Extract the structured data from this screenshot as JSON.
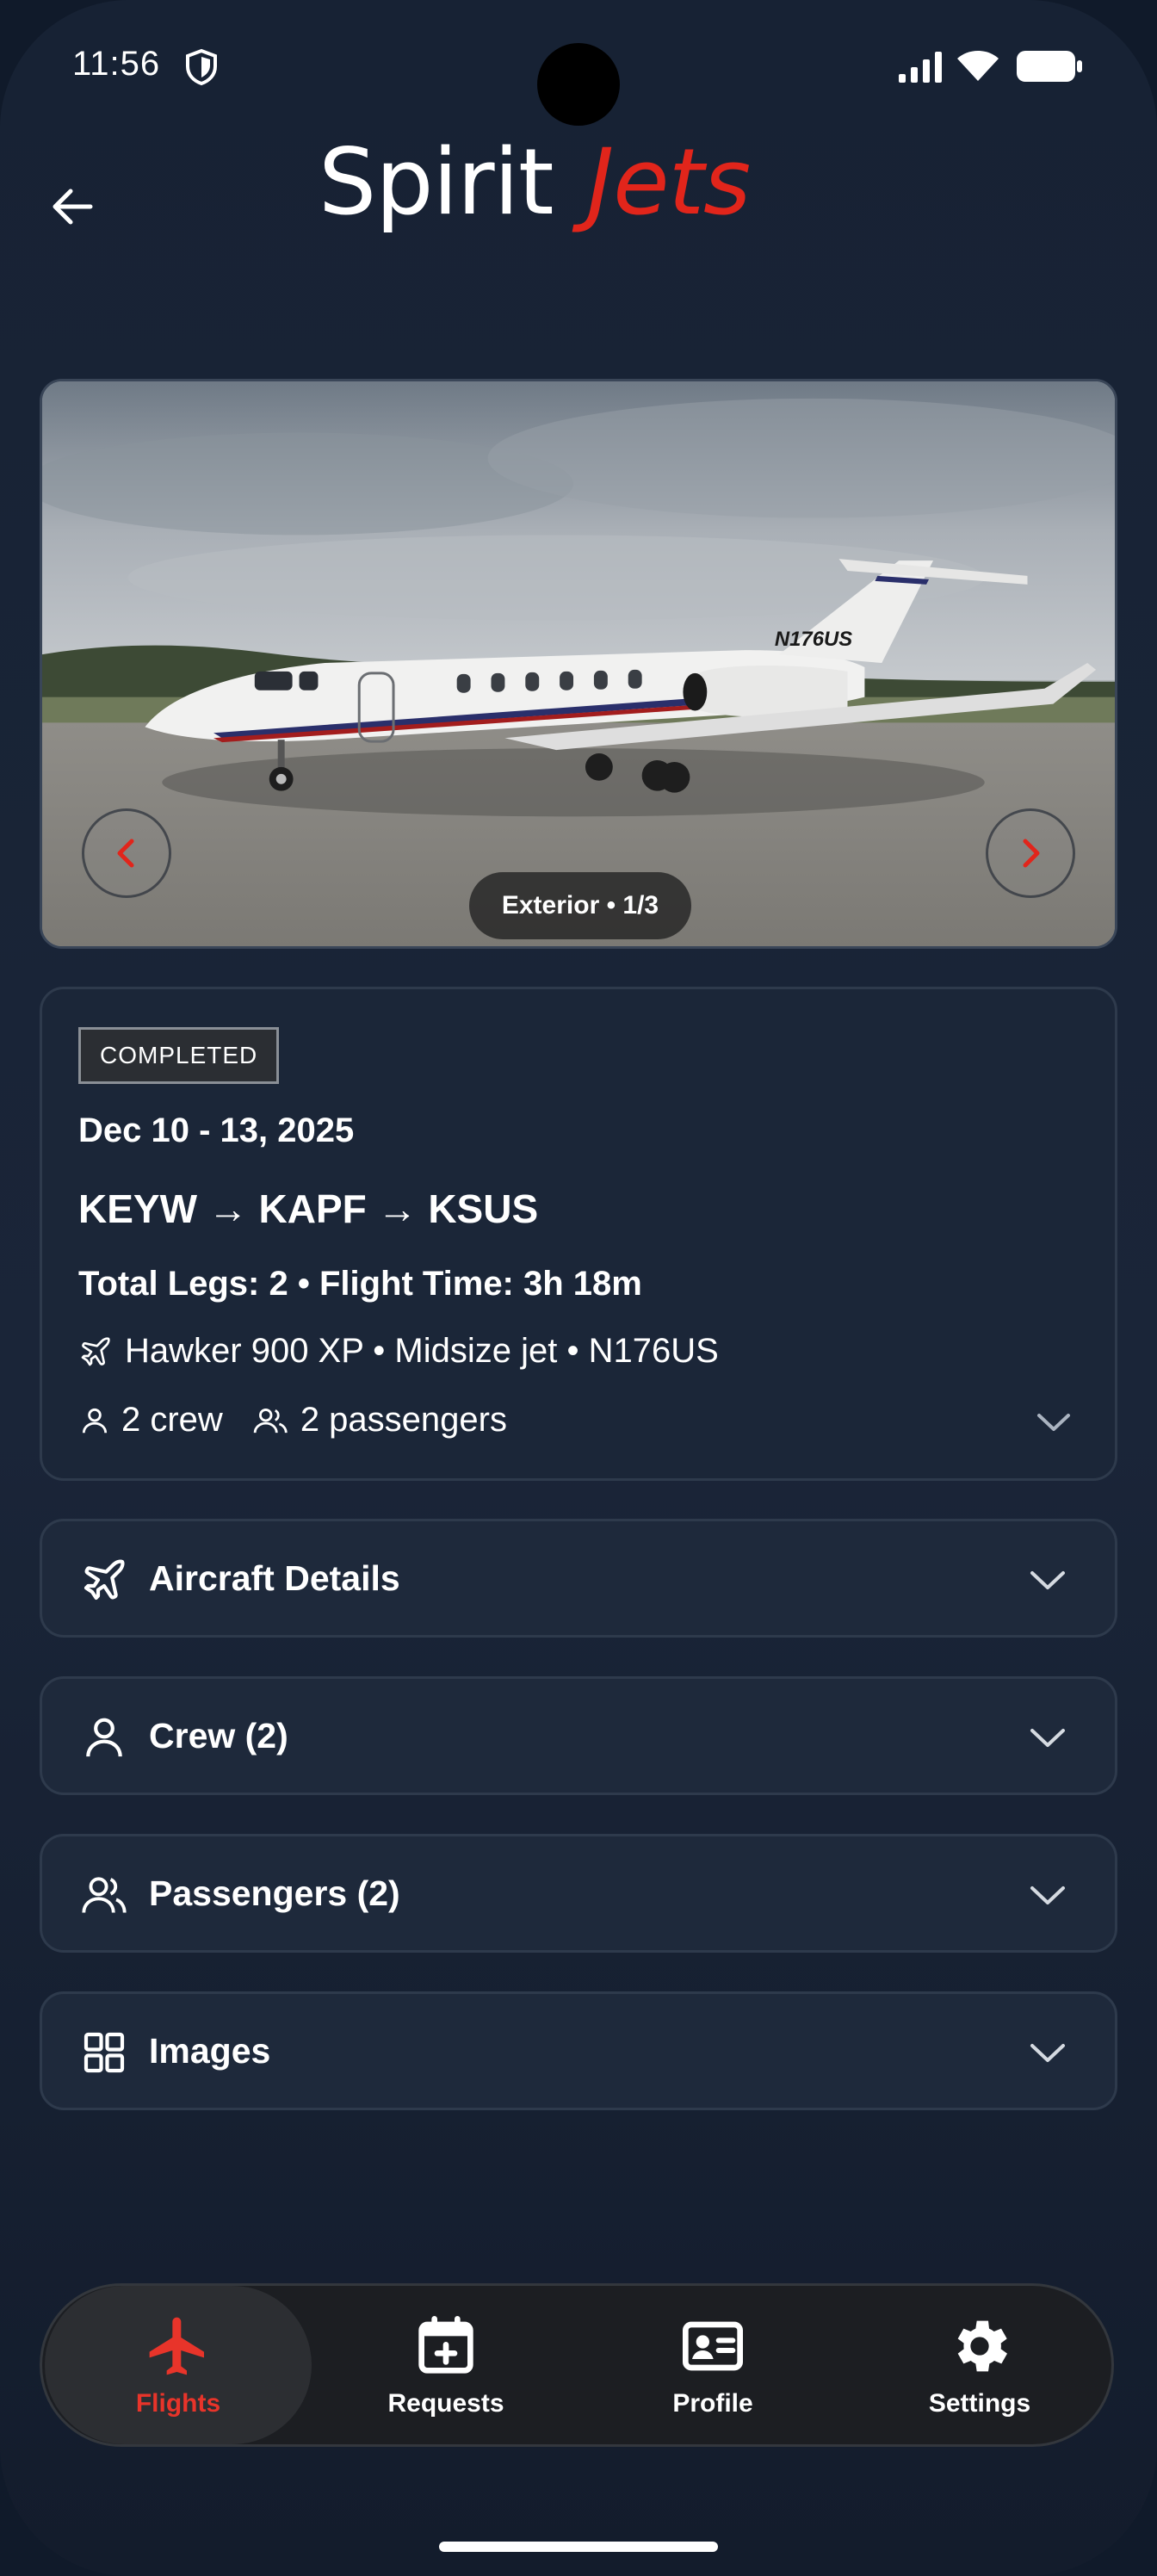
{
  "status_bar": {
    "time": "11:56",
    "icons": [
      "shield-icon",
      "signal-icon",
      "wifi-icon",
      "battery-icon"
    ]
  },
  "header": {
    "back_icon": "arrow-left-icon",
    "brand_part1": "Spirit",
    "brand_part2": "Jets",
    "brand_accent": "#e1251b"
  },
  "hero": {
    "caption": "Exterior • 1/3",
    "aircraft_tail": "N176US",
    "prev_icon": "chevron-left-icon",
    "next_icon": "chevron-right-icon",
    "arrow_color": "#e1251b"
  },
  "summary": {
    "status": "COMPLETED",
    "dates": "Dec 10 - 13, 2025",
    "route": "KEYW → KAPF → KSUS",
    "legs": "Total Legs: 2 • Flight Time: 3h 18m",
    "aircraft": "Hawker 900 XP • Midsize jet • N176US",
    "crew": "2 crew",
    "passengers": "2 passengers"
  },
  "sections": [
    {
      "label": "Aircraft Details",
      "icon": "plane-icon"
    },
    {
      "label": "Crew (2)",
      "icon": "person-icon"
    },
    {
      "label": "Passengers (2)",
      "icon": "people-icon"
    },
    {
      "label": "Images",
      "icon": "grid-icon"
    }
  ],
  "nav": {
    "items": [
      {
        "label": "Flights",
        "icon": "plane-icon",
        "active": true
      },
      {
        "label": "Requests",
        "icon": "calendar-plus-icon",
        "active": false
      },
      {
        "label": "Profile",
        "icon": "id-card-icon",
        "active": false
      },
      {
        "label": "Settings",
        "icon": "gear-icon",
        "active": false
      }
    ],
    "active_color": "#e8342a"
  }
}
